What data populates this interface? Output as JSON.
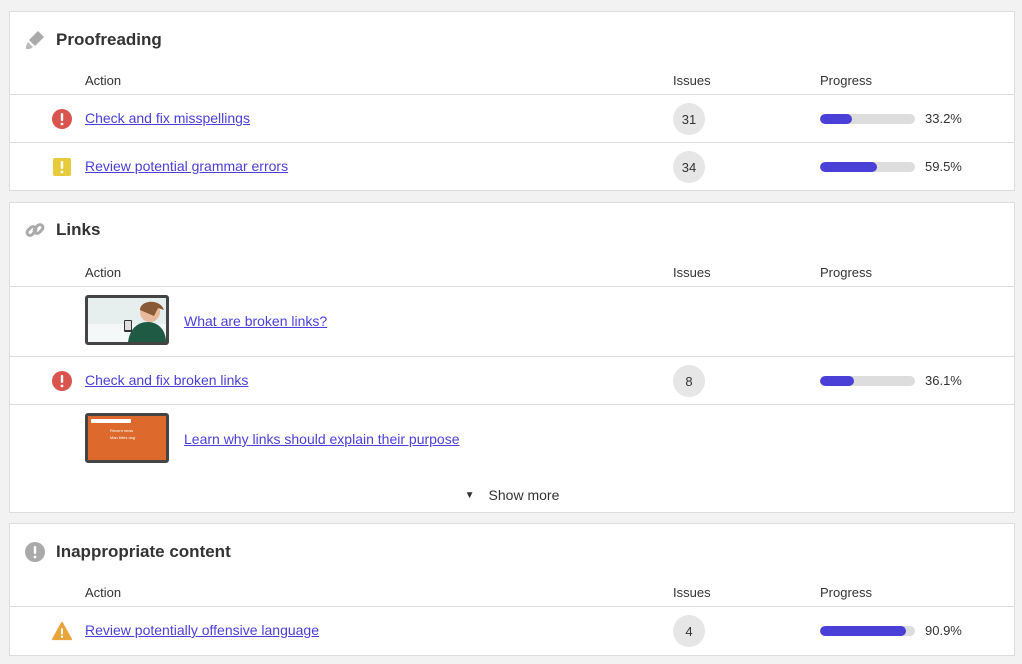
{
  "columns": {
    "action": "Action",
    "issues": "Issues",
    "progress": "Progress"
  },
  "accent": "#4a3fd6",
  "sections": [
    {
      "title": "Proofreading",
      "icon": "highlighter-icon",
      "rows": [
        {
          "label": "Check and fix misspellings",
          "severity": "error",
          "issues": "31",
          "progress": 0.332,
          "progress_label": "33.2%"
        },
        {
          "label": "Review potential grammar errors",
          "severity": "warning-yellow",
          "issues": "34",
          "progress": 0.595,
          "progress_label": "59.5%"
        }
      ]
    },
    {
      "title": "Links",
      "icon": "link-icon",
      "video1": {
        "label": "What are broken links?"
      },
      "row": {
        "label": "Check and fix broken links",
        "severity": "error",
        "issues": "8",
        "progress": 0.361,
        "progress_label": "36.1%"
      },
      "video2": {
        "label": "Learn why links should explain their purpose",
        "thumb_lines": [
          "Recent news",
          "Man bites dog"
        ]
      },
      "show_more": "Show more"
    },
    {
      "title": "Inappropriate content",
      "icon": "exclamation-circle-icon",
      "rows": [
        {
          "label": "Review potentially offensive language",
          "severity": "warning-triangle",
          "issues": "4",
          "progress": 0.909,
          "progress_label": "90.9%"
        }
      ]
    }
  ]
}
